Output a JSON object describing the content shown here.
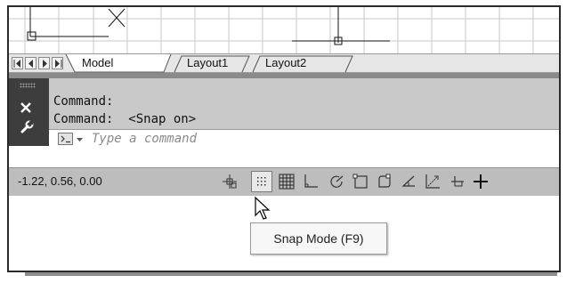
{
  "layout_tabs": [
    "Model",
    "Layout1",
    "Layout2"
  ],
  "command_history": [
    "Command:",
    "Command:  <Snap on>"
  ],
  "command_input": {
    "placeholder": "Type a command"
  },
  "status_bar": {
    "coordinates": "-1.22, 0.56, 0.00",
    "buttons": [
      "model-space",
      "snap-mode",
      "grid-display",
      "ortho-mode",
      "polar-tracking",
      "object-snap",
      "object-snap-tracking",
      "dynamic-ucs",
      "dynamic-input",
      "lineweight",
      "add-crosshair"
    ]
  },
  "tooltip": "Snap Mode (F9)",
  "icons": [
    "close-icon",
    "wrench-icon",
    "prompt-icon",
    "cursor-arrow-icon"
  ],
  "colors": {
    "command_bar": "#3d3d3d",
    "command_area": "#c9c9c9",
    "status_bar": "#bdbdbd"
  }
}
